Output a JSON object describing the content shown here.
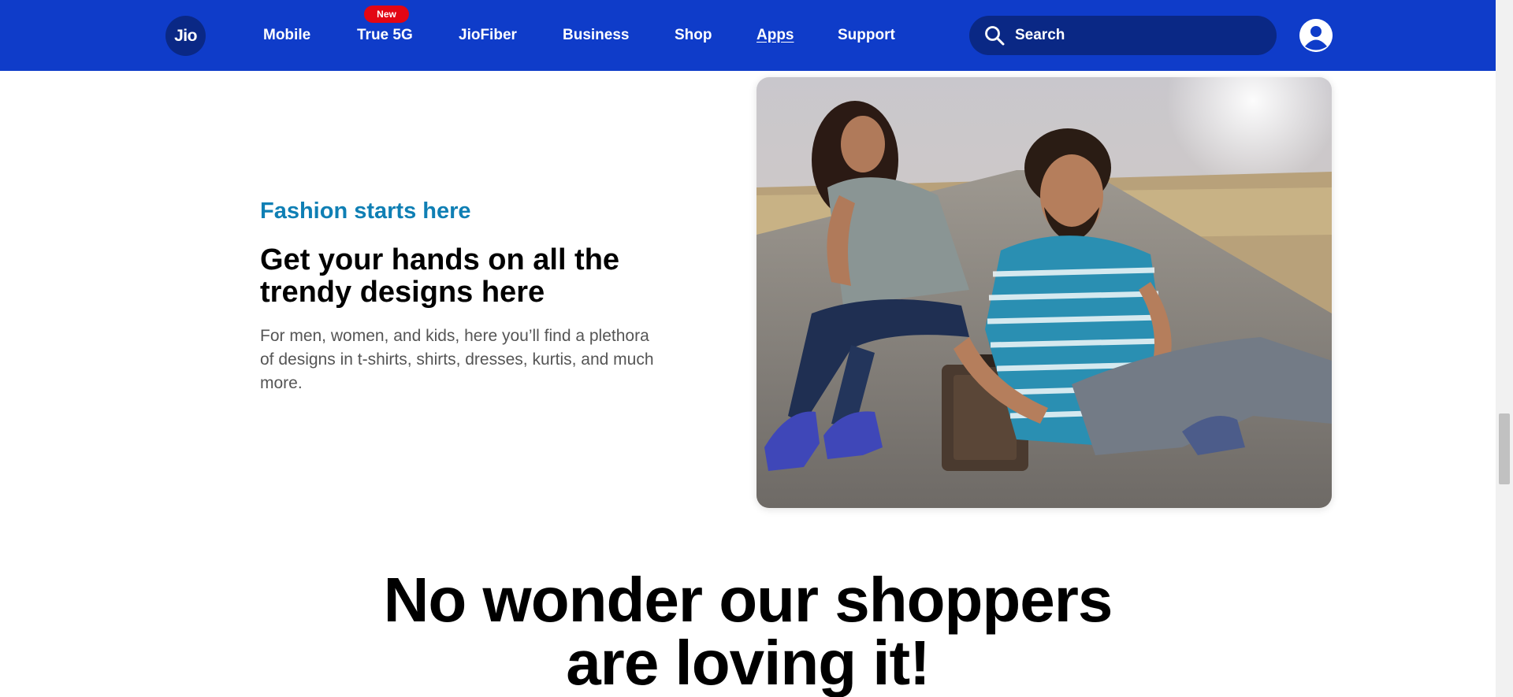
{
  "header": {
    "logo_text": "Jio",
    "nav": [
      {
        "label": "Mobile"
      },
      {
        "label": "True 5G",
        "badge": "New"
      },
      {
        "label": "JioFiber"
      },
      {
        "label": "Business"
      },
      {
        "label": "Shop"
      },
      {
        "label": "Apps",
        "active": true
      },
      {
        "label": "Support"
      }
    ],
    "search_placeholder": "Search",
    "brand_color": "#0f3cc9",
    "badge_color": "#e30613"
  },
  "feature": {
    "eyebrow": "Fashion starts here",
    "title": "Get your hands on all the trendy designs here",
    "description": "For men, women, and kids, here you’ll find a plethora of designs in t-shirts, shirts, dresses, kurtis, and much more.",
    "eyebrow_color": "#0f7fb4"
  },
  "bottom": {
    "heading": "No wonder our shoppers are loving it!"
  }
}
